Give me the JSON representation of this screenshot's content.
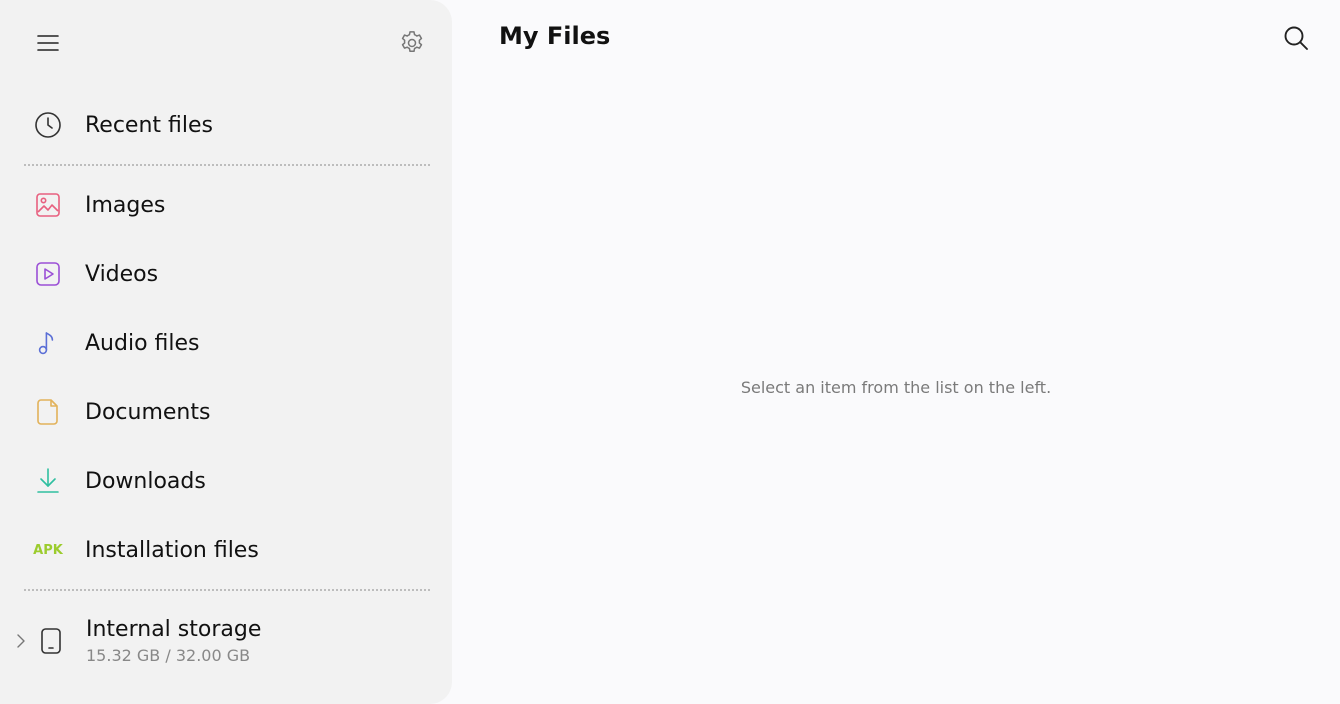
{
  "sidebar": {
    "menu_icon": "hamburger-menu-icon",
    "settings_icon": "gear-icon",
    "recent": {
      "label": "Recent files",
      "icon": "clock-icon"
    },
    "categories": [
      {
        "label": "Images",
        "icon": "image-icon",
        "color": "#e8607f"
      },
      {
        "label": "Videos",
        "icon": "video-icon",
        "color": "#9b4fd6"
      },
      {
        "label": "Audio files",
        "icon": "music-note-icon",
        "color": "#5b6fd6"
      },
      {
        "label": "Documents",
        "icon": "document-icon",
        "color": "#e2b25a"
      },
      {
        "label": "Downloads",
        "icon": "download-icon",
        "color": "#2fbfa0"
      },
      {
        "label": "Installation files",
        "icon": "apk-icon",
        "icon_text": "APK",
        "color": "#9ccc2e"
      }
    ],
    "storage": {
      "name": "Internal storage",
      "size": "15.32 GB / 32.00 GB",
      "icon": "phone-icon"
    }
  },
  "main": {
    "title": "My Files",
    "search_icon": "search-icon",
    "empty_message": "Select an item from the list on the left."
  }
}
